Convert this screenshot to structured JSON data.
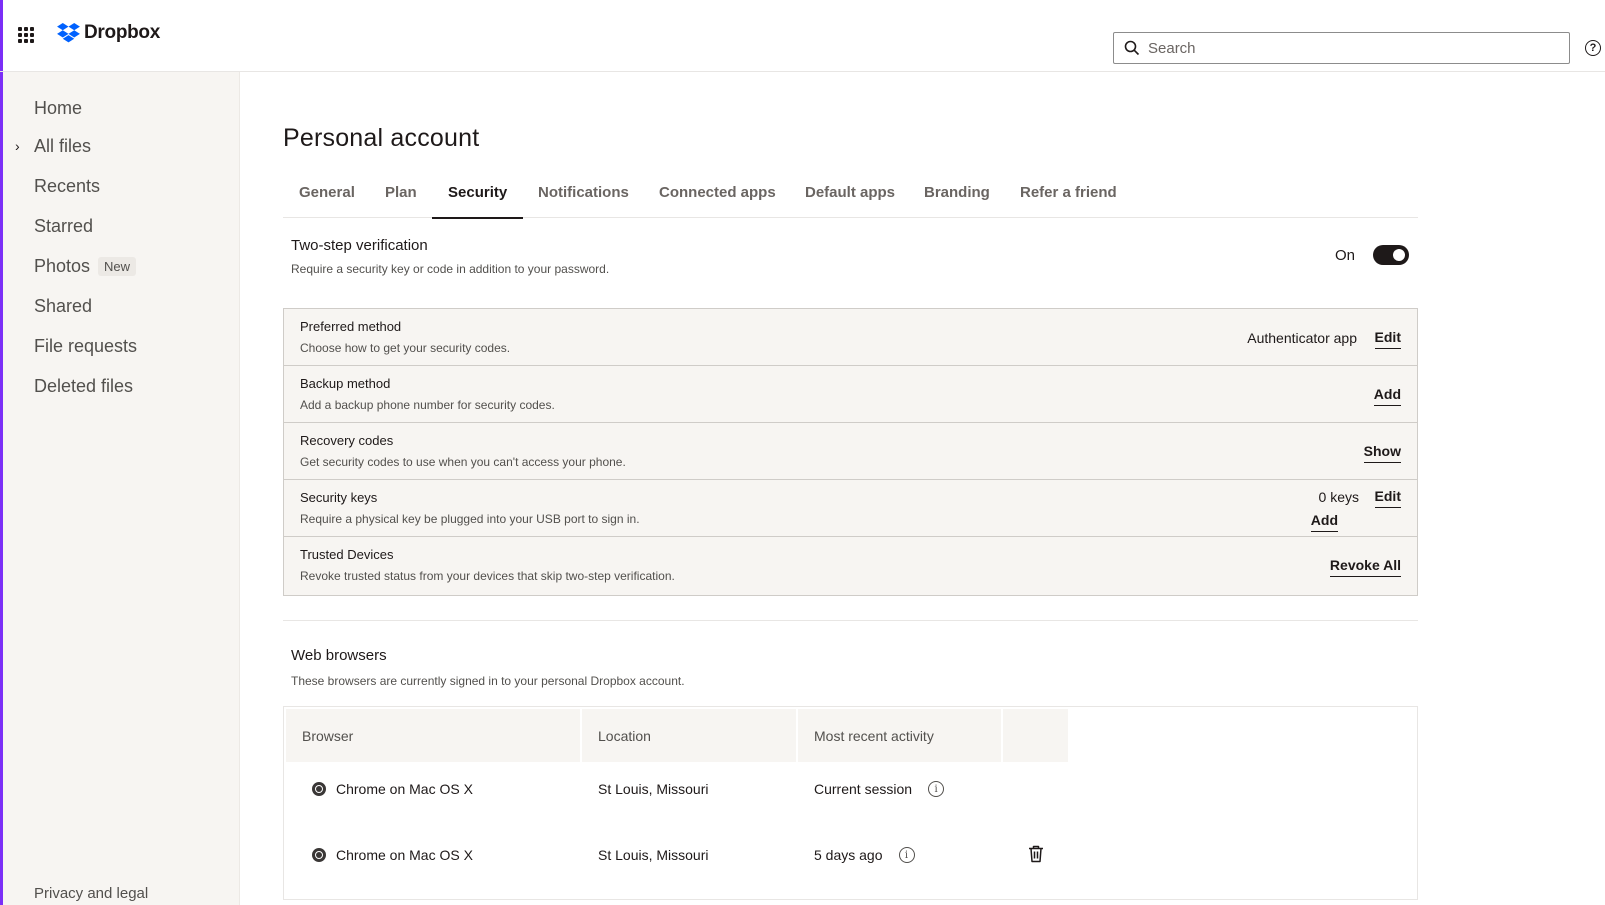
{
  "header": {
    "brand": "Dropbox",
    "search_placeholder": "Search",
    "help_glyph": "?"
  },
  "sidebar": {
    "items": [
      {
        "label": "Home"
      },
      {
        "label": "All files",
        "expandable": true
      },
      {
        "label": "Recents"
      },
      {
        "label": "Starred"
      },
      {
        "label": "Photos",
        "badge": "New"
      },
      {
        "label": "Shared"
      },
      {
        "label": "File requests"
      },
      {
        "label": "Deleted files"
      }
    ],
    "footer": "Privacy and legal"
  },
  "page": {
    "title": "Personal account",
    "tabs": [
      "General",
      "Plan",
      "Security",
      "Notifications",
      "Connected apps",
      "Default apps",
      "Branding",
      "Refer a friend"
    ],
    "active_tab": "Security"
  },
  "two_step": {
    "title": "Two-step verification",
    "subtitle": "Require a security key or code in addition to your password.",
    "status": "On",
    "enabled": true
  },
  "methods": [
    {
      "title": "Preferred method",
      "subtitle": "Choose how to get your security codes.",
      "value": "Authenticator app",
      "action": "Edit"
    },
    {
      "title": "Backup method",
      "subtitle": "Add a backup phone number for security codes.",
      "action": "Add"
    },
    {
      "title": "Recovery codes",
      "subtitle": "Get security codes to use when you can't access your phone.",
      "action": "Show"
    },
    {
      "title": "Security keys",
      "subtitle": "Require a physical key be plugged into your USB port to sign in.",
      "value": "0 keys",
      "action": "Edit",
      "action2": "Add"
    },
    {
      "title": "Trusted Devices",
      "subtitle": "Revoke trusted status from your devices that skip two-step verification.",
      "action": "Revoke All"
    }
  ],
  "web_browsers": {
    "title": "Web browsers",
    "subtitle": "These browsers are currently signed in to your personal Dropbox account.",
    "columns": [
      "Browser",
      "Location",
      "Most recent activity",
      ""
    ],
    "rows": [
      {
        "browser": "Chrome on Mac OS X",
        "location": "St Louis, Missouri",
        "activity": "Current session"
      },
      {
        "browser": "Chrome on Mac OS X",
        "location": "St Louis, Missouri",
        "activity": "5 days ago"
      }
    ]
  },
  "colors": {
    "accent": "#7b2ff7",
    "brand_blue": "#0061fe",
    "sidebar_bg": "#f7f5f2",
    "text": "#1e1919"
  },
  "icons": [
    "app-grid-icon",
    "dropbox-logo-icon",
    "search-icon",
    "help-icon",
    "chevron-right-icon",
    "chrome-icon",
    "info-icon",
    "trash-icon"
  ]
}
